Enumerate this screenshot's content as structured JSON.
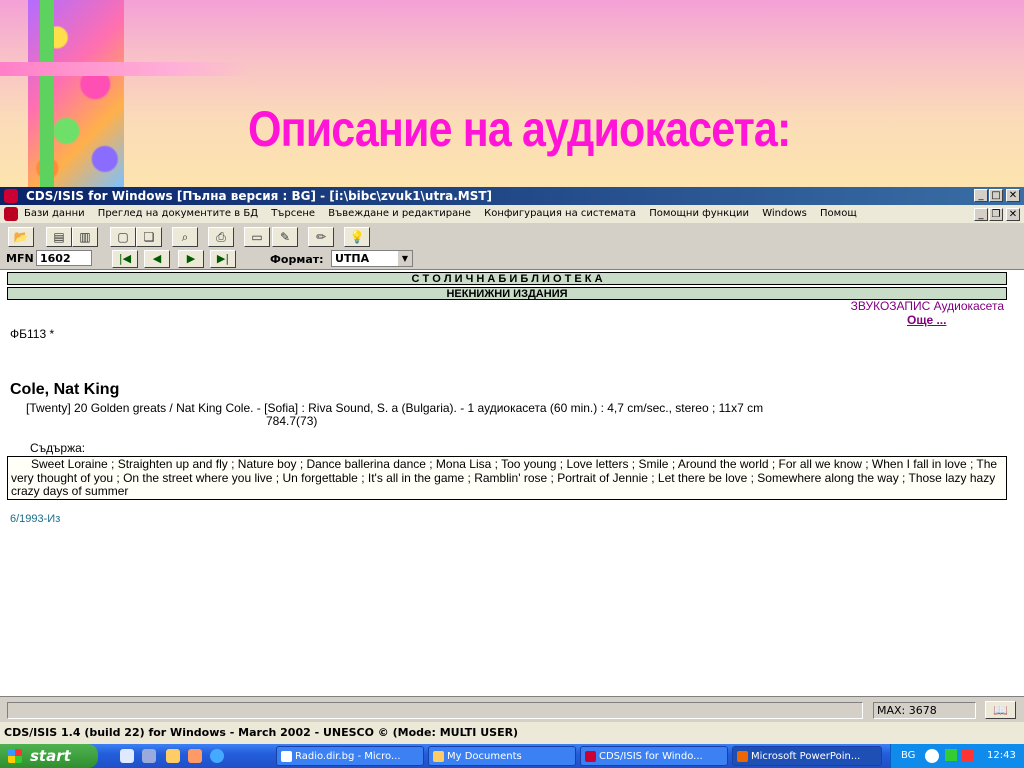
{
  "slide": {
    "title": "Описание на аудиокасета:"
  },
  "window": {
    "title": "CDS/ISIS for Windows [Пълна версия : BG] - [i:\\bibc\\zvuk1\\utra.MST]"
  },
  "menu": [
    "Бази данни",
    "Преглед на документите в БД",
    "Търсене",
    "Въвеждане и редактиране",
    "Конфигурация на системата",
    "Помощни функции",
    "Windows",
    "Помощ"
  ],
  "toolbar": {
    "mfn_label": "MFN",
    "mfn_value": "1602",
    "format_label": "Формат:",
    "format_value": "UTПА"
  },
  "record": {
    "header1": "С Т О Л И Ч Н А   Б И Б Л И О Т Е К А",
    "header2": "НЕКНИЖНИ  ИЗДАНИЯ",
    "material": "ЗВУКОЗАПИС Аудиокасета",
    "more_link": "Още ...",
    "shelfmark": "ФБ113  *",
    "author": "Cole, Nat King",
    "description": "[Twenty] 20 Golden greats / Nat King Cole. - [Sofia] : Riva Sound, S. a (Bulgaria). - 1 аудиокасета (60 min.) : 4,7 cm/sec., stereo ; 11x7 cm",
    "classification": "784.7(73)",
    "contents_label": "Съдържа:",
    "contents": "Sweet Loraine ; Straighten up and fly ; Nature boy ; Dance ballerina dance ; Mona Lisa ; Too young ; Love letters ; Smile ; Around the world ; For all we know ; When I fall in love ; The very thought of you ; On the street where you live ; Un forgettable ; It's all in the game ; Ramblin' rose ; Portrait of Jennie ; Let there be love ; Somewhere along the way ; Those lazy hazy crazy days of summer",
    "footer_code": "6/1993-Из"
  },
  "status": {
    "max": "MAX: 3678",
    "info": "CDS/ISIS 1.4 (build 22) for Windows - March 2002 - UNESCO ©  (Mode: MULTI USER)"
  },
  "taskbar": {
    "start": "start",
    "tasks": [
      "Radio.dir.bg - Micro...",
      "My Documents",
      "CDS/ISIS for Windo...",
      "Microsoft PowerPoin..."
    ],
    "lang": "BG",
    "clock": "12:43"
  }
}
